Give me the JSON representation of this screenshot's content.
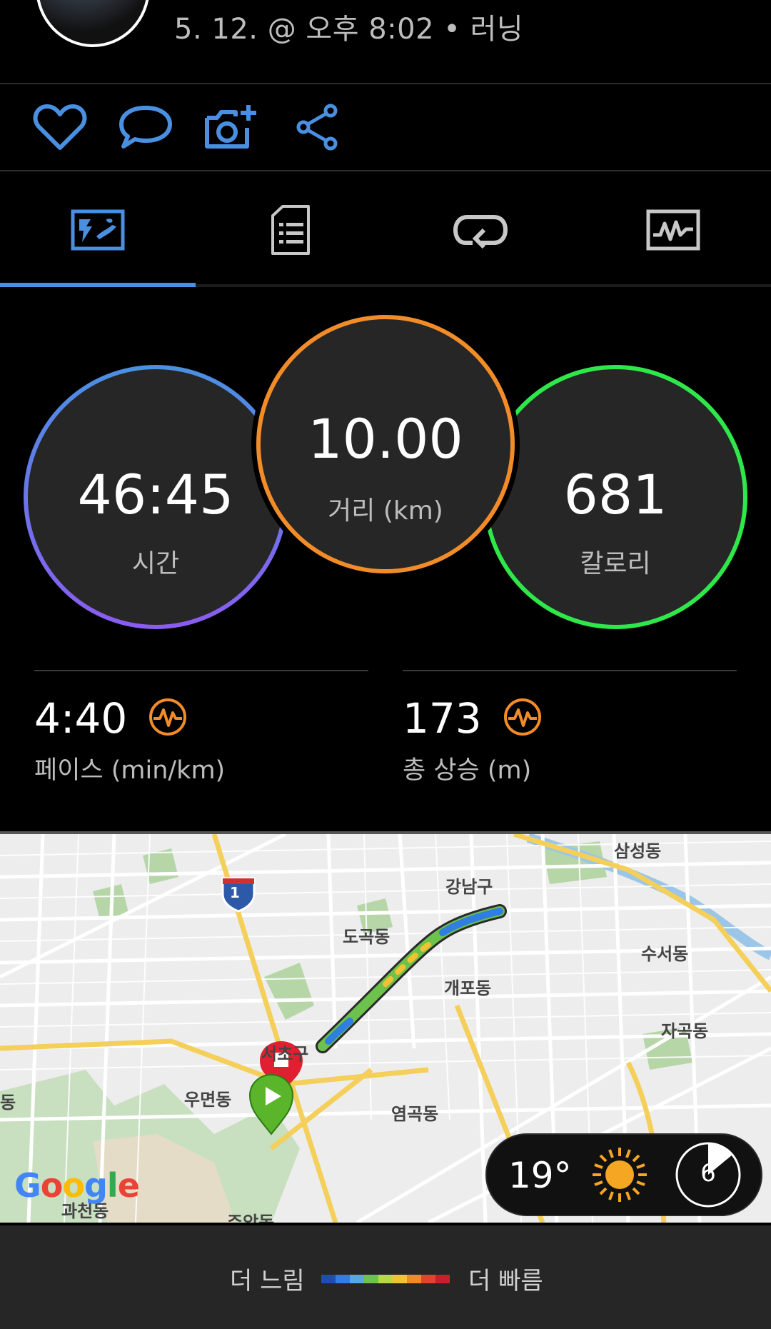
{
  "header": {
    "subtitle": "5. 12. @ 오후 8:02 • 러닝"
  },
  "actions": {
    "like_icon": "heart-icon",
    "comment_icon": "comment-icon",
    "photo_icon": "add-photo-icon",
    "share_icon": "share-icon"
  },
  "tabs": [
    {
      "icon": "map-overview-icon",
      "active": true
    },
    {
      "icon": "details-document-icon",
      "active": false
    },
    {
      "icon": "laps-loop-icon",
      "active": false
    },
    {
      "icon": "graph-chart-icon",
      "active": false
    }
  ],
  "stats": {
    "time": {
      "value": "46:45",
      "label": "시간"
    },
    "distance": {
      "value": "10.00",
      "label": "거리 (km)"
    },
    "calories": {
      "value": "681",
      "label": "칼로리"
    }
  },
  "metrics": {
    "pace": {
      "value": "4:40",
      "label": "페이스 (min/km)",
      "icon": "performance-icon"
    },
    "ascent": {
      "value": "173",
      "label": "총 상승 (m)",
      "icon": "performance-icon"
    }
  },
  "map": {
    "labels": {
      "samseong": "삼성동",
      "gangnam": "강남구",
      "dogok": "도곡동",
      "suseo": "수서동",
      "gaepo": "개포동",
      "jagok": "자곡동",
      "seocho": "서초구",
      "umyeon": "우면동",
      "yeomgok": "염곡동",
      "gwacheon": "과천동",
      "juam": "주암동",
      "route_shield": "1",
      "edge_dong": "동"
    },
    "google_logo": "Google",
    "weather": {
      "temperature": "19°",
      "wind": "6",
      "condition_icon": "sun-icon"
    }
  },
  "legend": {
    "slow": "더 느림",
    "fast": "더 빠름",
    "colors": [
      "#1e4fb0",
      "#2f7ee0",
      "#55a8e8",
      "#6cc24a",
      "#b8d84a",
      "#f1c232",
      "#ee8a2a",
      "#e0452b",
      "#c8202a"
    ]
  },
  "colors": {
    "accent": "#4a90e2",
    "time_ring_start": "#4a90e2",
    "time_ring_end": "#8a5cf0",
    "distance_ring": "#f28c28",
    "calories_ring": "#2ee84a",
    "metric_icon": "#f28c28"
  }
}
